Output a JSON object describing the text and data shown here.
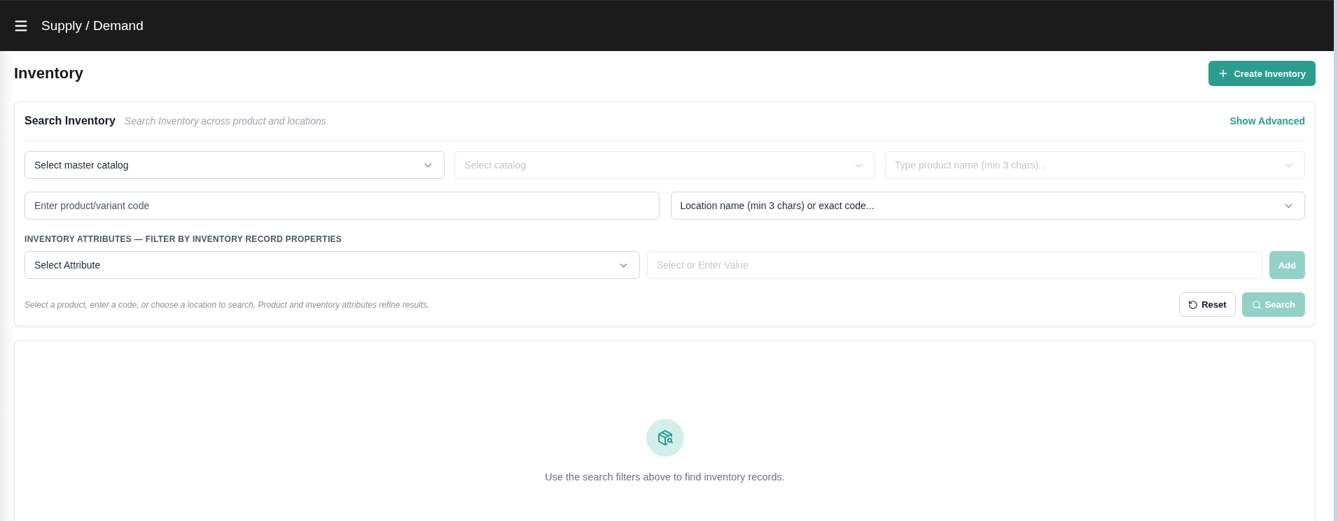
{
  "top_bar": {
    "title": "Supply / Demand"
  },
  "header": {
    "title": "Inventory",
    "create_button": "Create Inventory"
  },
  "search_panel": {
    "title": "Search Inventory",
    "subtitle": "Search Inventory across product and locations",
    "advanced_link": "Show Advanced",
    "filter_rows": [
      {
        "fields": [
          {
            "kind": "select",
            "placeholder": "Select master catalog",
            "disabled": false
          },
          {
            "kind": "select",
            "placeholder": "Select catalog",
            "disabled": true
          },
          {
            "kind": "select",
            "placeholder": "Type product name (min 3 chars)...",
            "disabled": true
          }
        ]
      },
      {
        "fields": [
          {
            "kind": "input",
            "placeholder": "Enter product/variant code",
            "disabled": false
          },
          {
            "kind": "select",
            "placeholder": "Location name (min 3 chars) or exact code...",
            "disabled": false
          }
        ]
      }
    ],
    "attributes": {
      "heading": "INVENTORY ATTRIBUTES — FILTER BY INVENTORY RECORD PROPERTIES",
      "fields": [
        {
          "kind": "select",
          "placeholder": "Select Attribute",
          "disabled": false
        },
        {
          "kind": "input",
          "placeholder": "Select or Enter Value",
          "disabled": true
        }
      ],
      "add_button": {
        "label": "Add",
        "disabled": true
      }
    },
    "hint": "Select a product, enter a code, or choose a location to search. Product and inventory attributes refine results.",
    "actions": [
      {
        "kind": "reset",
        "label": "Reset",
        "disabled": false
      },
      {
        "kind": "search",
        "label": "Search",
        "disabled": true
      }
    ]
  },
  "results": {
    "empty_message": "Use the search filters above to find inventory records."
  }
}
